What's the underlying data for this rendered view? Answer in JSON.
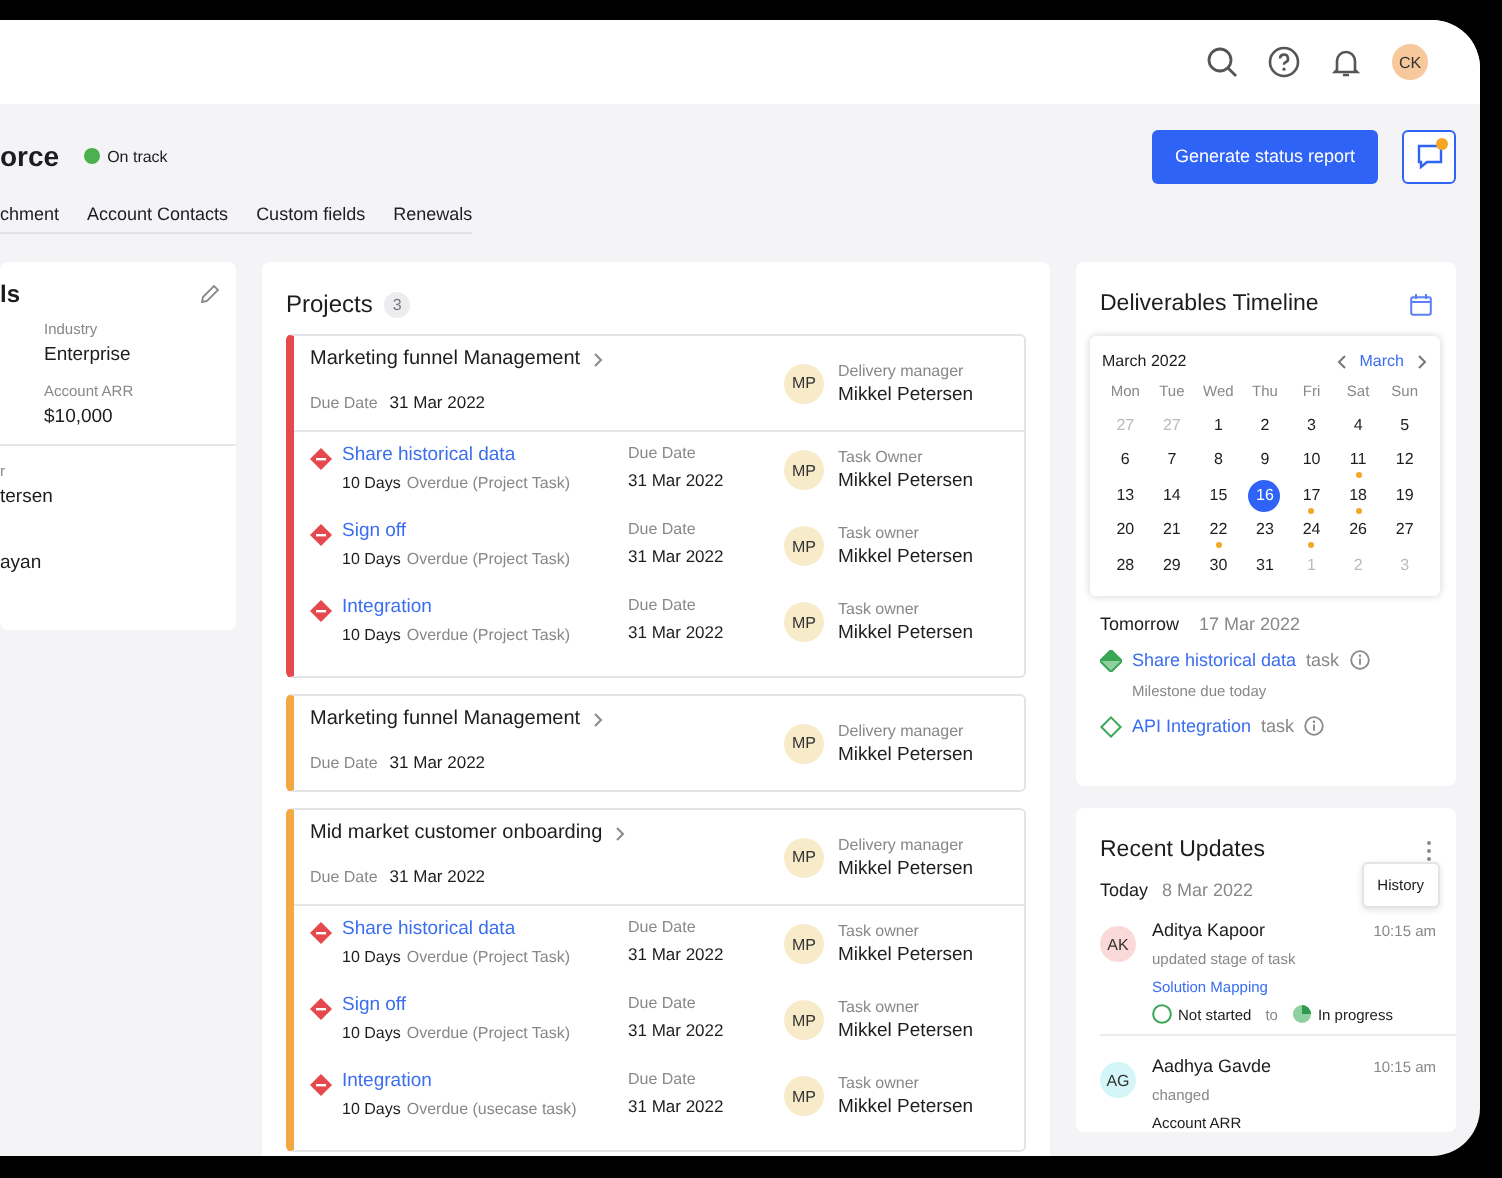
{
  "header": {
    "avatar": "CK"
  },
  "page": {
    "title": "orce",
    "status": {
      "label": "On track",
      "color": "#4caf50"
    },
    "primary_button": "Generate status report",
    "chat_button": {
      "has_notification": true
    }
  },
  "tabs": [
    {
      "label": "chment"
    },
    {
      "label": "Account Contacts"
    },
    {
      "label": "Custom fields"
    },
    {
      "label": "Renewals"
    }
  ],
  "details_card": {
    "title": "ls",
    "fields": [
      {
        "label": "Industry",
        "value": "Enterprise"
      },
      {
        "label": "Account ARR",
        "value": "$10,000"
      }
    ],
    "people": [
      {
        "label": "r",
        "value": "tersen"
      },
      {
        "value": "ayan"
      }
    ]
  },
  "projects": {
    "title": "Projects",
    "count": "3",
    "items": [
      {
        "title": "Marketing funnel Management",
        "due_label": "Due Date",
        "due": "31 Mar 2022",
        "color": "#e5484d",
        "manager": {
          "initials": "MP",
          "role": "Delivery manager",
          "name": "Mikkel Petersen"
        },
        "tasks": [
          {
            "name": "Share historical data",
            "overdue": "10 Days",
            "note": "Overdue (Project Task)",
            "due_label": "Due Date",
            "due": "31 Mar 2022",
            "owner": {
              "initials": "MP",
              "role": "Task Owner",
              "name": "Mikkel Petersen"
            }
          },
          {
            "name": "Sign off",
            "overdue": "10 Days",
            "note": "Overdue (Project Task)",
            "due_label": "Due Date",
            "due": "31 Mar 2022",
            "owner": {
              "initials": "MP",
              "role": "Task owner",
              "name": "Mikkel Petersen"
            }
          },
          {
            "name": "Integration",
            "overdue": "10 Days",
            "note": "Overdue (Project Task)",
            "due_label": "Due Date",
            "due": "31 Mar 2022",
            "owner": {
              "initials": "MP",
              "role": "Task owner",
              "name": "Mikkel Petersen"
            }
          }
        ]
      },
      {
        "title": "Marketing funnel Management",
        "due_label": "Due Date",
        "due": "31 Mar 2022",
        "color": "#f5a742",
        "manager": {
          "initials": "MP",
          "role": "Delivery manager",
          "name": "Mikkel Petersen"
        }
      },
      {
        "title": "Mid market customer onboarding",
        "due_label": "Due Date",
        "due": "31 Mar 2022",
        "color": "#f5a742",
        "manager": {
          "initials": "MP",
          "role": "Delivery manager",
          "name": "Mikkel Petersen"
        },
        "tasks": [
          {
            "name": "Share historical data",
            "overdue": "10 Days",
            "note": "Overdue (Project Task)",
            "due_label": "Due Date",
            "due": "31 Mar 2022",
            "owner": {
              "initials": "MP",
              "role": "Task owner",
              "name": "Mikkel Petersen"
            }
          },
          {
            "name": "Sign off",
            "overdue": "10 Days",
            "note": "Overdue (Project Task)",
            "due_label": "Due Date",
            "due": "31 Mar 2022",
            "owner": {
              "initials": "MP",
              "role": "Task owner",
              "name": "Mikkel Petersen"
            }
          },
          {
            "name": "Integration",
            "overdue": "10 Days",
            "note": "Overdue (usecase task)",
            "due_label": "Due Date",
            "due": "31 Mar 2022",
            "owner": {
              "initials": "MP",
              "role": "Task owner",
              "name": "Mikkel Petersen"
            }
          }
        ]
      }
    ]
  },
  "timeline": {
    "title": "Deliverables Timeline",
    "calendar": {
      "month_label": "March 2022",
      "nav_label": "March",
      "weekdays": [
        "Mon",
        "Tue",
        "Wed",
        "Thu",
        "Fri",
        "Sat",
        "Sun"
      ],
      "weeks": [
        [
          {
            "day": "27",
            "muted": true,
            "selected": false,
            "event": false
          },
          {
            "day": "27",
            "muted": true,
            "selected": false,
            "event": false
          },
          {
            "day": "1",
            "muted": false,
            "selected": false,
            "event": false
          },
          {
            "day": "2",
            "muted": false,
            "selected": false,
            "event": false
          },
          {
            "day": "3",
            "muted": false,
            "selected": false,
            "event": false
          },
          {
            "day": "4",
            "muted": false,
            "selected": false,
            "event": false
          },
          {
            "day": "5",
            "muted": false,
            "selected": false,
            "event": false
          }
        ],
        [
          {
            "day": "6",
            "muted": false,
            "selected": false,
            "event": false
          },
          {
            "day": "7",
            "muted": false,
            "selected": false,
            "event": false
          },
          {
            "day": "8",
            "muted": false,
            "selected": false,
            "event": false
          },
          {
            "day": "9",
            "muted": false,
            "selected": false,
            "event": false
          },
          {
            "day": "10",
            "muted": false,
            "selected": false,
            "event": false
          },
          {
            "day": "11",
            "muted": false,
            "selected": false,
            "event": true
          },
          {
            "day": "12",
            "muted": false,
            "selected": false,
            "event": false
          }
        ],
        [
          {
            "day": "13",
            "muted": false,
            "selected": false,
            "event": false
          },
          {
            "day": "14",
            "muted": false,
            "selected": false,
            "event": false
          },
          {
            "day": "15",
            "muted": false,
            "selected": false,
            "event": false
          },
          {
            "day": "16",
            "muted": false,
            "selected": true,
            "event": false
          },
          {
            "day": "17",
            "muted": false,
            "selected": false,
            "event": true
          },
          {
            "day": "18",
            "muted": false,
            "selected": false,
            "event": true
          },
          {
            "day": "19",
            "muted": false,
            "selected": false,
            "event": false
          }
        ],
        [
          {
            "day": "20",
            "muted": false,
            "selected": false,
            "event": false
          },
          {
            "day": "21",
            "muted": false,
            "selected": false,
            "event": false
          },
          {
            "day": "22",
            "muted": false,
            "selected": false,
            "event": true
          },
          {
            "day": "23",
            "muted": false,
            "selected": false,
            "event": false
          },
          {
            "day": "24",
            "muted": false,
            "selected": false,
            "event": true
          },
          {
            "day": "26",
            "muted": false,
            "selected": false,
            "event": false
          },
          {
            "day": "27",
            "muted": false,
            "selected": false,
            "event": false
          }
        ],
        [
          {
            "day": "28",
            "muted": false,
            "selected": false,
            "event": false
          },
          {
            "day": "29",
            "muted": false,
            "selected": false,
            "event": false
          },
          {
            "day": "30",
            "muted": false,
            "selected": false,
            "event": false
          },
          {
            "day": "31",
            "muted": false,
            "selected": false,
            "event": false
          },
          {
            "day": "1",
            "muted": true,
            "selected": false,
            "event": false
          },
          {
            "day": "2",
            "muted": true,
            "selected": false,
            "event": false
          },
          {
            "day": "3",
            "muted": true,
            "selected": false,
            "event": false
          }
        ]
      ]
    },
    "day": {
      "label": "Tomorrow",
      "date": "17 Mar 2022"
    },
    "items": [
      {
        "kind": "half",
        "name": "Share historical data",
        "type": "task",
        "note": "Milestone due today"
      },
      {
        "kind": "empty",
        "name": "API Integration",
        "type": "task"
      }
    ]
  },
  "updates": {
    "title": "Recent Updates",
    "tooltip": "History",
    "day": {
      "label": "Today",
      "date": "8 Mar 2022"
    },
    "entries": [
      {
        "initials": "AK",
        "color": "#fbd9d9",
        "name": "Aditya Kapoor",
        "time": "10:15 am",
        "action": "updated stage of task",
        "link": "Solution Mapping",
        "from": "Not started",
        "connector": "to",
        "to": "In progress"
      },
      {
        "initials": "AG",
        "color": "#d5f6f8",
        "name": "Aadhya Gavde",
        "time": "10:15 am",
        "action": "changed",
        "field": "Account ARR"
      }
    ]
  }
}
